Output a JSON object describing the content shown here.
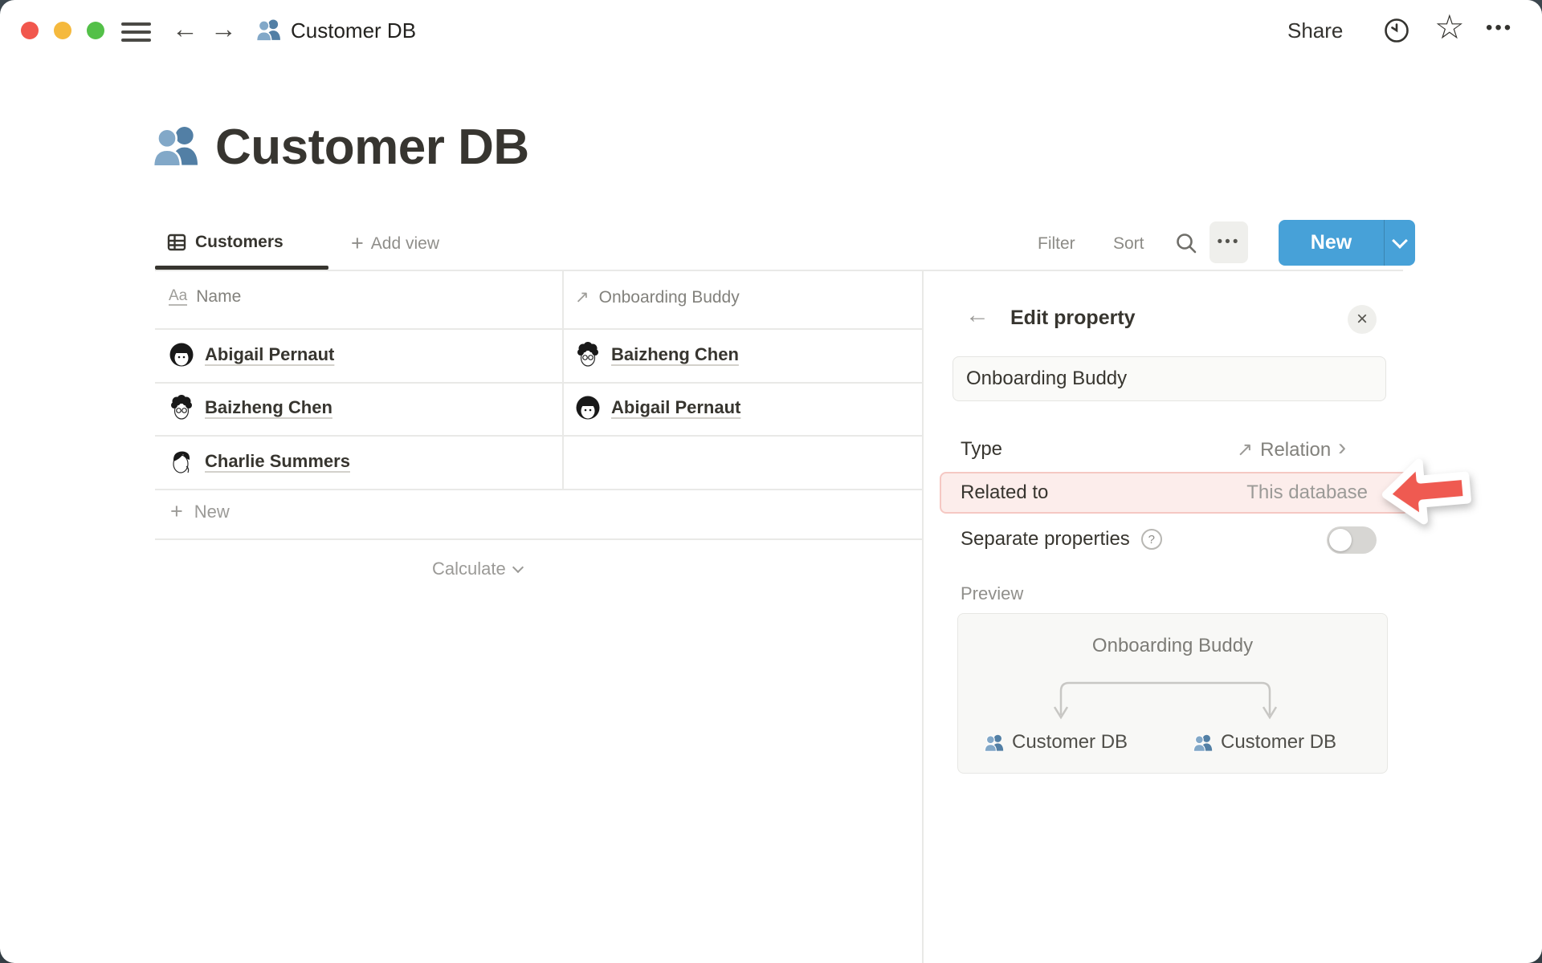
{
  "titlebar": {
    "breadcrumb_title": "Customer DB",
    "share_label": "Share"
  },
  "page": {
    "title": "Customer DB"
  },
  "view_bar": {
    "active_tab": "Customers",
    "add_view_label": "Add view",
    "filter_label": "Filter",
    "sort_label": "Sort",
    "new_label": "New"
  },
  "table": {
    "columns": [
      {
        "icon": "Aa",
        "label": "Name"
      },
      {
        "icon": "up-right-arrow",
        "label": "Onboarding Buddy"
      }
    ],
    "rows": [
      {
        "name": "Abigail Pernaut",
        "buddy": "Baizheng Chen"
      },
      {
        "name": "Baizheng Chen",
        "buddy": "Abigail Pernaut"
      },
      {
        "name": "Charlie Summers",
        "buddy": ""
      }
    ],
    "new_row_label": "New",
    "calculate_label": "Calculate"
  },
  "panel": {
    "title": "Edit property",
    "name_value": "Onboarding Buddy",
    "type_label": "Type",
    "type_value": "Relation",
    "related_label": "Related to",
    "related_value": "This database",
    "separate_label": "Separate properties",
    "preview_label": "Preview",
    "preview": {
      "relation": "Onboarding Buddy",
      "left_db": "Customer DB",
      "right_db": "Customer DB"
    }
  },
  "icons": {
    "back": "←",
    "forward": "→",
    "ellipsis": "•••",
    "star": "☆",
    "plus": "+",
    "close": "×",
    "up_right": "↗",
    "chevron_right": "›",
    "help": "?",
    "title_prop": "Aa"
  },
  "colors": {
    "accent_blue": "#47A1D8",
    "highlight_bg": "#FCEDEB",
    "highlight_border": "#F5C8C3",
    "arrow_red": "#EF5A51",
    "people_icon_blue": "#527FA5"
  }
}
